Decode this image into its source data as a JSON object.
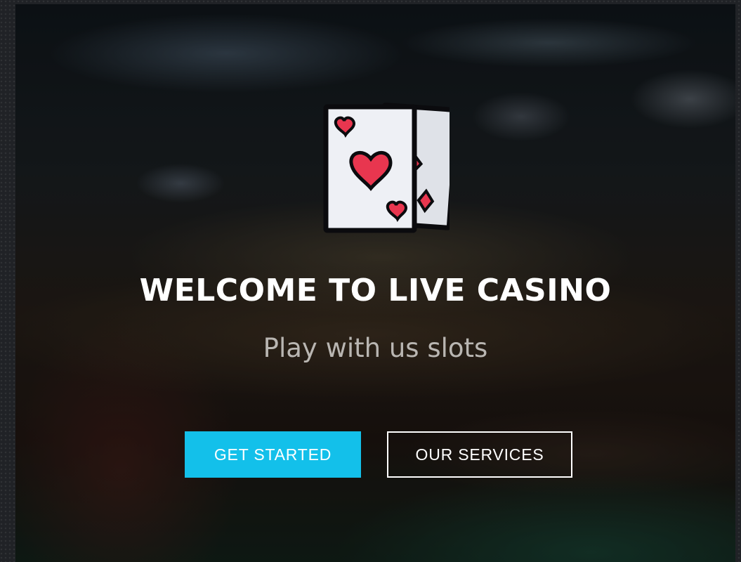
{
  "hero": {
    "logo_icon": "playing-cards-icon",
    "title": "WELCOME TO LIVE CASINO",
    "subtitle": "Play with us slots"
  },
  "actions": {
    "get_started_label": "GET STARTED",
    "our_services_label": "OUR SERVICES"
  },
  "colors": {
    "accent": "#13c0ea",
    "heart_red": "#e8364f",
    "card_face": "#eef0f5",
    "outline": "#0b0b0e"
  }
}
